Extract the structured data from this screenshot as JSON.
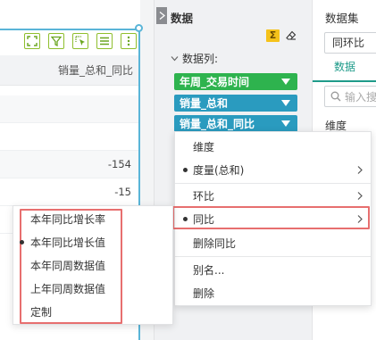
{
  "table": {
    "column_header": "销量_总和_同比",
    "rows": [
      "",
      "",
      "",
      "-154",
      "-15",
      "",
      ""
    ]
  },
  "toolbar": {
    "icons": [
      "expand-icon",
      "filter-icon",
      "select-cursor-icon",
      "list-icon",
      "more-vertical-icon"
    ]
  },
  "data_panel": {
    "title": "数据",
    "fields_label": "数据列:",
    "fields": [
      {
        "label": "年周_交易时间",
        "color": "#2eb34e"
      },
      {
        "label": "销量_总和",
        "color": "#2a9bbf"
      },
      {
        "label": "销量_总和_同比",
        "color": "#2a9bbf"
      }
    ]
  },
  "right_panel": {
    "dataset_label": "数据集",
    "dataset_value": "同环比",
    "tab_label": "数据",
    "search_placeholder": "输入搜",
    "dimension_label": "维度"
  },
  "context_menu": {
    "items": [
      {
        "label": "维度",
        "has_dot": false,
        "has_arrow": false
      },
      {
        "label": "度量(总和)",
        "has_dot": true,
        "has_arrow": true
      },
      {
        "label": "环比",
        "has_dot": false,
        "has_arrow": true
      },
      {
        "label": "同比",
        "has_dot": true,
        "has_arrow": true,
        "highlighted": true
      },
      {
        "label": "删除同比",
        "has_dot": false,
        "has_arrow": false
      },
      {
        "label": "别名...",
        "has_dot": false,
        "has_arrow": false
      },
      {
        "label": "删除",
        "has_dot": false,
        "has_arrow": false
      }
    ]
  },
  "submenu": {
    "items": [
      {
        "label": "本年同比增长率",
        "selected": false
      },
      {
        "label": "本年同比增长值",
        "selected": true
      },
      {
        "label": "本年同周数据值",
        "selected": false
      },
      {
        "label": "上年同周数据值",
        "selected": false
      },
      {
        "label": "定制",
        "selected": false
      }
    ]
  },
  "colors": {
    "accent_blue": "#5ab5d8",
    "highlight_red": "#e76f6f",
    "tab_green": "#1f9b8a",
    "toolbar_icon_green": "#8fbf2e"
  }
}
